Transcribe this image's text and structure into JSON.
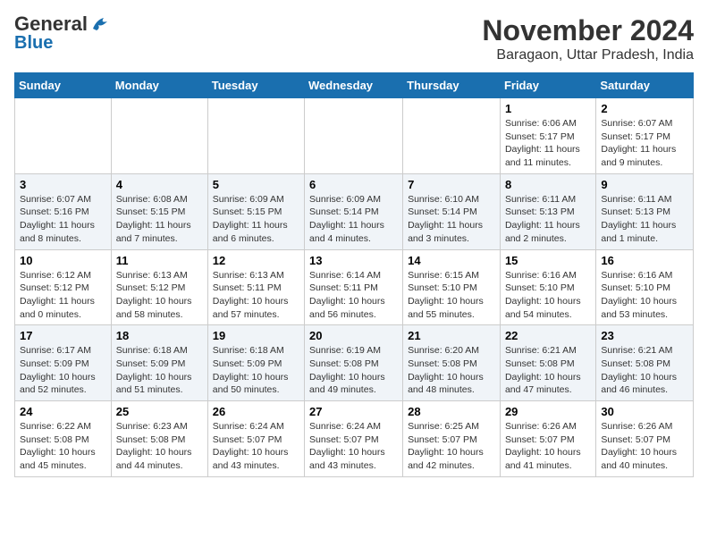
{
  "header": {
    "logo_general": "General",
    "logo_blue": "Blue",
    "month_title": "November 2024",
    "subtitle": "Baragaon, Uttar Pradesh, India"
  },
  "calendar": {
    "headers": [
      "Sunday",
      "Monday",
      "Tuesday",
      "Wednesday",
      "Thursday",
      "Friday",
      "Saturday"
    ],
    "weeks": [
      {
        "days": [
          {
            "num": "",
            "info": ""
          },
          {
            "num": "",
            "info": ""
          },
          {
            "num": "",
            "info": ""
          },
          {
            "num": "",
            "info": ""
          },
          {
            "num": "",
            "info": ""
          },
          {
            "num": "1",
            "info": "Sunrise: 6:06 AM\nSunset: 5:17 PM\nDaylight: 11 hours and 11 minutes."
          },
          {
            "num": "2",
            "info": "Sunrise: 6:07 AM\nSunset: 5:17 PM\nDaylight: 11 hours and 9 minutes."
          }
        ]
      },
      {
        "days": [
          {
            "num": "3",
            "info": "Sunrise: 6:07 AM\nSunset: 5:16 PM\nDaylight: 11 hours and 8 minutes."
          },
          {
            "num": "4",
            "info": "Sunrise: 6:08 AM\nSunset: 5:15 PM\nDaylight: 11 hours and 7 minutes."
          },
          {
            "num": "5",
            "info": "Sunrise: 6:09 AM\nSunset: 5:15 PM\nDaylight: 11 hours and 6 minutes."
          },
          {
            "num": "6",
            "info": "Sunrise: 6:09 AM\nSunset: 5:14 PM\nDaylight: 11 hours and 4 minutes."
          },
          {
            "num": "7",
            "info": "Sunrise: 6:10 AM\nSunset: 5:14 PM\nDaylight: 11 hours and 3 minutes."
          },
          {
            "num": "8",
            "info": "Sunrise: 6:11 AM\nSunset: 5:13 PM\nDaylight: 11 hours and 2 minutes."
          },
          {
            "num": "9",
            "info": "Sunrise: 6:11 AM\nSunset: 5:13 PM\nDaylight: 11 hours and 1 minute."
          }
        ]
      },
      {
        "days": [
          {
            "num": "10",
            "info": "Sunrise: 6:12 AM\nSunset: 5:12 PM\nDaylight: 11 hours and 0 minutes."
          },
          {
            "num": "11",
            "info": "Sunrise: 6:13 AM\nSunset: 5:12 PM\nDaylight: 10 hours and 58 minutes."
          },
          {
            "num": "12",
            "info": "Sunrise: 6:13 AM\nSunset: 5:11 PM\nDaylight: 10 hours and 57 minutes."
          },
          {
            "num": "13",
            "info": "Sunrise: 6:14 AM\nSunset: 5:11 PM\nDaylight: 10 hours and 56 minutes."
          },
          {
            "num": "14",
            "info": "Sunrise: 6:15 AM\nSunset: 5:10 PM\nDaylight: 10 hours and 55 minutes."
          },
          {
            "num": "15",
            "info": "Sunrise: 6:16 AM\nSunset: 5:10 PM\nDaylight: 10 hours and 54 minutes."
          },
          {
            "num": "16",
            "info": "Sunrise: 6:16 AM\nSunset: 5:10 PM\nDaylight: 10 hours and 53 minutes."
          }
        ]
      },
      {
        "days": [
          {
            "num": "17",
            "info": "Sunrise: 6:17 AM\nSunset: 5:09 PM\nDaylight: 10 hours and 52 minutes."
          },
          {
            "num": "18",
            "info": "Sunrise: 6:18 AM\nSunset: 5:09 PM\nDaylight: 10 hours and 51 minutes."
          },
          {
            "num": "19",
            "info": "Sunrise: 6:18 AM\nSunset: 5:09 PM\nDaylight: 10 hours and 50 minutes."
          },
          {
            "num": "20",
            "info": "Sunrise: 6:19 AM\nSunset: 5:08 PM\nDaylight: 10 hours and 49 minutes."
          },
          {
            "num": "21",
            "info": "Sunrise: 6:20 AM\nSunset: 5:08 PM\nDaylight: 10 hours and 48 minutes."
          },
          {
            "num": "22",
            "info": "Sunrise: 6:21 AM\nSunset: 5:08 PM\nDaylight: 10 hours and 47 minutes."
          },
          {
            "num": "23",
            "info": "Sunrise: 6:21 AM\nSunset: 5:08 PM\nDaylight: 10 hours and 46 minutes."
          }
        ]
      },
      {
        "days": [
          {
            "num": "24",
            "info": "Sunrise: 6:22 AM\nSunset: 5:08 PM\nDaylight: 10 hours and 45 minutes."
          },
          {
            "num": "25",
            "info": "Sunrise: 6:23 AM\nSunset: 5:08 PM\nDaylight: 10 hours and 44 minutes."
          },
          {
            "num": "26",
            "info": "Sunrise: 6:24 AM\nSunset: 5:07 PM\nDaylight: 10 hours and 43 minutes."
          },
          {
            "num": "27",
            "info": "Sunrise: 6:24 AM\nSunset: 5:07 PM\nDaylight: 10 hours and 43 minutes."
          },
          {
            "num": "28",
            "info": "Sunrise: 6:25 AM\nSunset: 5:07 PM\nDaylight: 10 hours and 42 minutes."
          },
          {
            "num": "29",
            "info": "Sunrise: 6:26 AM\nSunset: 5:07 PM\nDaylight: 10 hours and 41 minutes."
          },
          {
            "num": "30",
            "info": "Sunrise: 6:26 AM\nSunset: 5:07 PM\nDaylight: 10 hours and 40 minutes."
          }
        ]
      }
    ]
  }
}
